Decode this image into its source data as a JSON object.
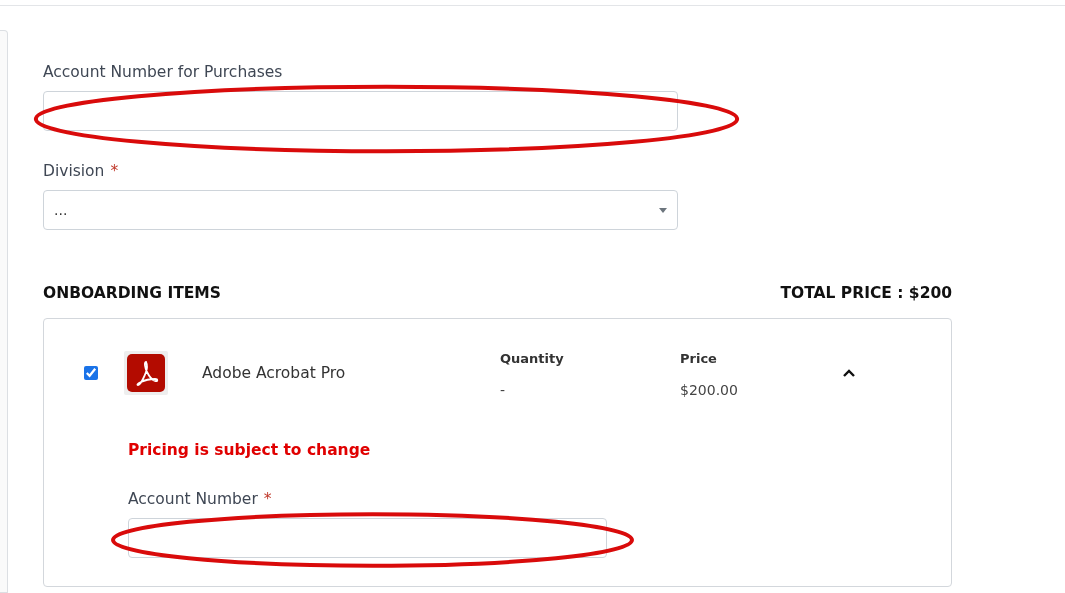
{
  "fields": [
    {
      "kind": "text",
      "label": "Account Number for Purchases",
      "circled": true
    },
    {
      "kind": "select",
      "label": "Division",
      "required_mark": "*",
      "value": "..."
    }
  ],
  "items_section": {
    "title": "ONBOARDING ITEMS",
    "total": "TOTAL PRICE : $200"
  },
  "items": [
    {
      "name": "Adobe Acrobat Pro",
      "checked": true,
      "expanded": true,
      "quantity_label": "Quantity",
      "quantity": "-",
      "price_label": "Price",
      "price": "$200.00",
      "notice": "Pricing is subject to change",
      "field": {
        "label": "Account Number",
        "required_mark": "*",
        "circled": true
      }
    }
  ]
}
